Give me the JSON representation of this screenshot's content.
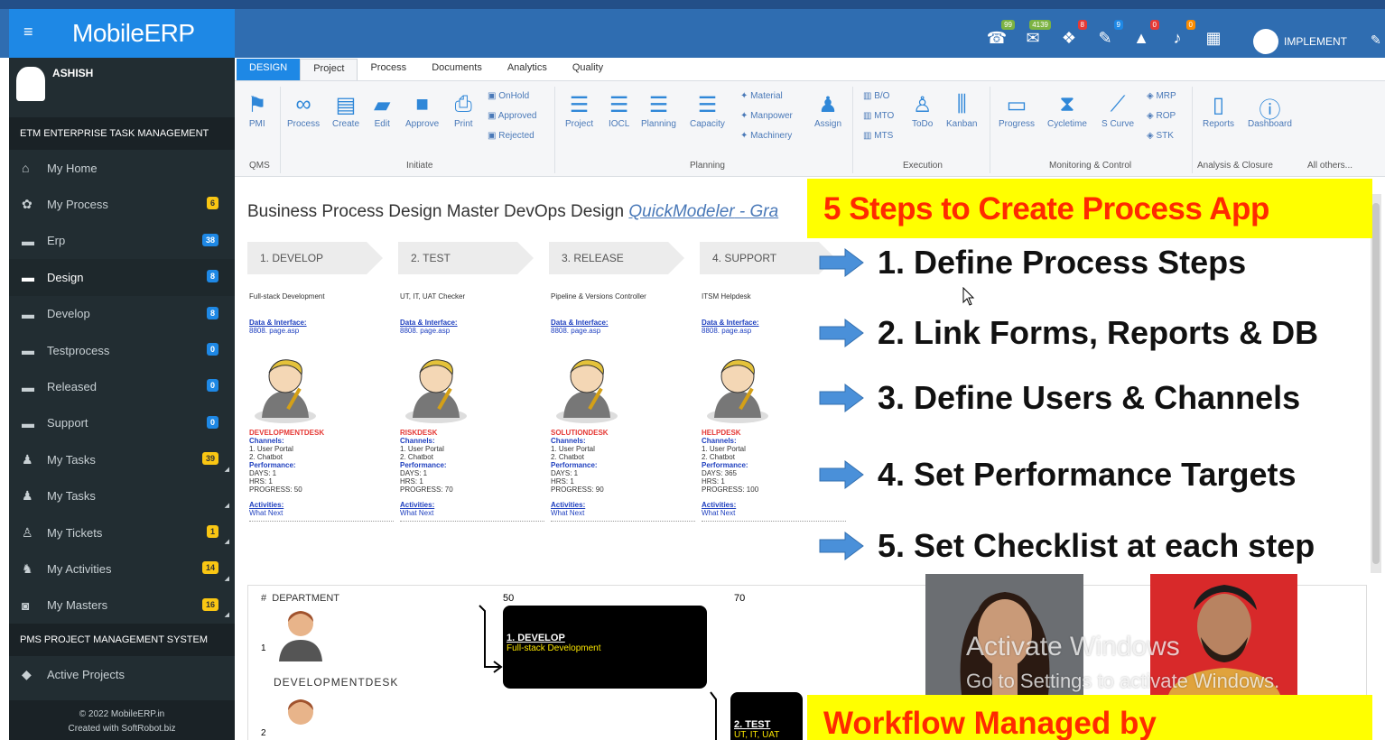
{
  "topbar": {
    "brand": "MobileERP",
    "menu_icon": "≡",
    "user": "IMPLEMENT",
    "icons": [
      {
        "name": "bell-icon",
        "glyph": "☎",
        "badge": "99",
        "cls": ""
      },
      {
        "name": "inbox-icon",
        "glyph": "✉",
        "badge": "4139",
        "cls": ""
      },
      {
        "name": "chat-icon",
        "glyph": "❖",
        "badge": "8",
        "cls": "red"
      },
      {
        "name": "link-icon",
        "glyph": "✎",
        "badge": "9",
        "cls": "blu"
      },
      {
        "name": "lock-icon",
        "glyph": "▲",
        "badge": "0",
        "cls": "red"
      },
      {
        "name": "alarm-icon",
        "glyph": "♪",
        "badge": "0",
        "cls": "org"
      },
      {
        "name": "grid-icon",
        "glyph": "▦",
        "badge": "",
        "cls": ""
      }
    ]
  },
  "sidebar": {
    "user": "ASHISH",
    "section1": "ETM ENTERPRISE TASK MANAGEMENT",
    "section2": "PMS PROJECT MANAGEMENT SYSTEM",
    "items": [
      {
        "label": "My Home",
        "icon": "⌂",
        "badge": "",
        "bc": ""
      },
      {
        "label": "My Process",
        "icon": "✿",
        "badge": "6",
        "bc": "bg-y"
      },
      {
        "label": "Erp",
        "icon": "▬",
        "badge": "38",
        "bc": "bg-b"
      },
      {
        "label": "Design",
        "icon": "▬",
        "badge": "8",
        "bc": "bg-b"
      },
      {
        "label": "Develop",
        "icon": "▬",
        "badge": "8",
        "bc": "bg-b"
      },
      {
        "label": "Testprocess",
        "icon": "▬",
        "badge": "0",
        "bc": "bg-b"
      },
      {
        "label": "Released",
        "icon": "▬",
        "badge": "0",
        "bc": "bg-b"
      },
      {
        "label": "Support",
        "icon": "▬",
        "badge": "0",
        "bc": "bg-b"
      },
      {
        "label": "My Tasks",
        "icon": "♟",
        "badge": "39",
        "bc": "bg-y"
      },
      {
        "label": "My Tasks",
        "icon": "♟",
        "badge": "",
        "bc": ""
      },
      {
        "label": "My Tickets",
        "icon": "♙",
        "badge": "1",
        "bc": "bg-y"
      },
      {
        "label": "My Activities",
        "icon": "♞",
        "badge": "14",
        "bc": "bg-y"
      },
      {
        "label": "My Masters",
        "icon": "◙",
        "badge": "16",
        "bc": "bg-y"
      }
    ],
    "pms_items": [
      {
        "label": "Active Projects",
        "icon": "◆"
      }
    ],
    "footer1": "© 2022 MobileERP.in",
    "footer2": "Created with SoftRobot.biz"
  },
  "ribbon": {
    "tabs": [
      "DESIGN",
      "Project",
      "Process",
      "Documents",
      "Analytics",
      "Quality"
    ],
    "buttons": {
      "pmi": "PMI",
      "process": "Process",
      "create": "Create",
      "edit": "Edit",
      "approve": "Approve",
      "print": "Print",
      "project": "Project",
      "iocl": "IOCL",
      "planning": "Planning",
      "capacity": "Capacity",
      "assign": "Assign",
      "todo": "ToDo",
      "kanban": "Kanban",
      "progress": "Progress",
      "cycletime": "Cycletime",
      "scurve": "S Curve",
      "reports": "Reports",
      "dashboard": "Dashboard"
    },
    "stacks": {
      "status": [
        "OnHold",
        "Approved",
        "Rejected"
      ],
      "resources": [
        "Material",
        "Manpower",
        "Machinery"
      ],
      "exec": [
        "B/O",
        "MTO",
        "MTS"
      ],
      "mrp": [
        "MRP",
        "ROP",
        "STK"
      ]
    },
    "groups": {
      "qms": "QMS",
      "initiate": "Initiate",
      "planning": "Planning",
      "execution": "Execution",
      "monitoring": "Monitoring & Control",
      "analysis": "Analysis & Closure",
      "others": "All others..."
    }
  },
  "main": {
    "title": "Business Process Design Master DevOps Design ",
    "quick": "QuickModeler",
    "quick2": " - Gra",
    "steps": [
      "1. DEVELOP",
      "2. TEST",
      "3. RELEASE",
      "4. SUPPORT"
    ],
    "columns": [
      {
        "title": "Full-stack Development",
        "desk": "DEVELOPMENTDESK",
        "days": "DAYS: 1",
        "hrs": "HRS: 1",
        "progress": "PROGRESS: 50"
      },
      {
        "title": "UT, IT, UAT Checker",
        "desk": "RISKDESK",
        "days": "DAYS: 1",
        "hrs": "HRS: 1",
        "progress": "PROGRESS: 70"
      },
      {
        "title": "Pipeline & Versions Controller",
        "desk": "SOLUTIONDESK",
        "days": "DAYS: 1",
        "hrs": "HRS: 1",
        "progress": "PROGRESS: 90"
      },
      {
        "title": "ITSM Helpdesk",
        "desk": "HELPDESK",
        "days": "DAYS: 365",
        "hrs": "HRS: 1",
        "progress": "PROGRESS: 100"
      }
    ],
    "common": {
      "data": "Data & Interface:",
      "page": "8808. page.asp",
      "channels": "Channels:",
      "ch1": "1. User Portal",
      "ch2": "2. Chatbot",
      "perf": "Performance:",
      "activities": "Activities:",
      "whatnext": "What Next"
    },
    "wf": {
      "hash": "#",
      "dept": "DEPARTMENT",
      "n50": "50",
      "n70": "70",
      "r1": "1",
      "r2": "2",
      "deskname": "DEVELOPMENTDESK",
      "b1": "1. DEVELOP",
      "b1s": "Full-stack Development",
      "b2": "2. TEST",
      "b2s": "UT, IT, UAT"
    }
  },
  "overlay": {
    "title": "5 Steps to Create Process App",
    "points": [
      "1. Define Process Steps",
      "2. Link Forms, Reports & DB",
      "3. Define Users & Channels",
      "4. Set Performance Targets",
      "5. Set Checklist at each step"
    ],
    "bottom": "Workflow Managed by"
  },
  "watermark": {
    "l1": "Activate Windows",
    "l2": "Go to Settings to activate Windows."
  },
  "colors": {
    "brand": "#1e88e5",
    "sidebar": "#222d32",
    "overlay": "#ffff00",
    "overlay_text": "#ff2a00"
  }
}
